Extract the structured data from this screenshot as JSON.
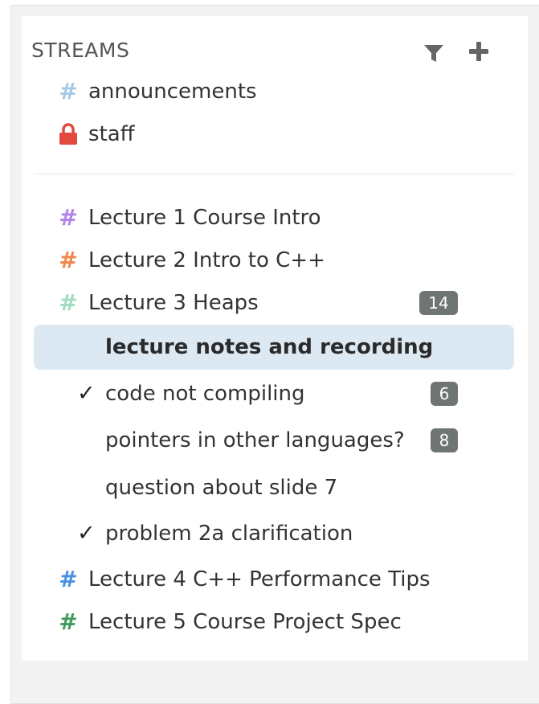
{
  "streams_header": {
    "title": "STREAMS"
  },
  "pinned_streams": [
    {
      "name": "announcements",
      "color": "#a6c7e5",
      "icon": "hash-icon"
    },
    {
      "name": "staff",
      "color": "#e34a3f",
      "icon": "lock-icon"
    }
  ],
  "streams": [
    {
      "name": "Lecture 1 Course Intro",
      "color": "#b084e8",
      "icon": "hash-icon"
    },
    {
      "name": "Lecture 2 Intro to C++",
      "color": "#f2844b",
      "icon": "hash-icon"
    },
    {
      "name": "Lecture 3 Heaps",
      "color": "#9fdcc1",
      "icon": "hash-icon",
      "unread": "14",
      "topics": [
        {
          "name": "lecture notes and recording",
          "selected": true,
          "resolved": false
        },
        {
          "name": "code not compiling",
          "resolved": true,
          "unread": "6",
          "check": "✓"
        },
        {
          "name": "pointers in other languages?",
          "resolved": false,
          "unread": "8"
        },
        {
          "name": "question about slide 7",
          "resolved": false
        },
        {
          "name": "problem 2a clarification",
          "resolved": true,
          "check": "✓"
        }
      ]
    },
    {
      "name": "Lecture 4 C++ Performance Tips",
      "color": "#4a90e2",
      "icon": "hash-icon"
    },
    {
      "name": "Lecture 5 Course Project Spec",
      "color": "#3f9a5c",
      "icon": "hash-icon"
    }
  ],
  "colors": {
    "selected_bg": "#dce9f2",
    "badge_bg": "#6f7571"
  }
}
